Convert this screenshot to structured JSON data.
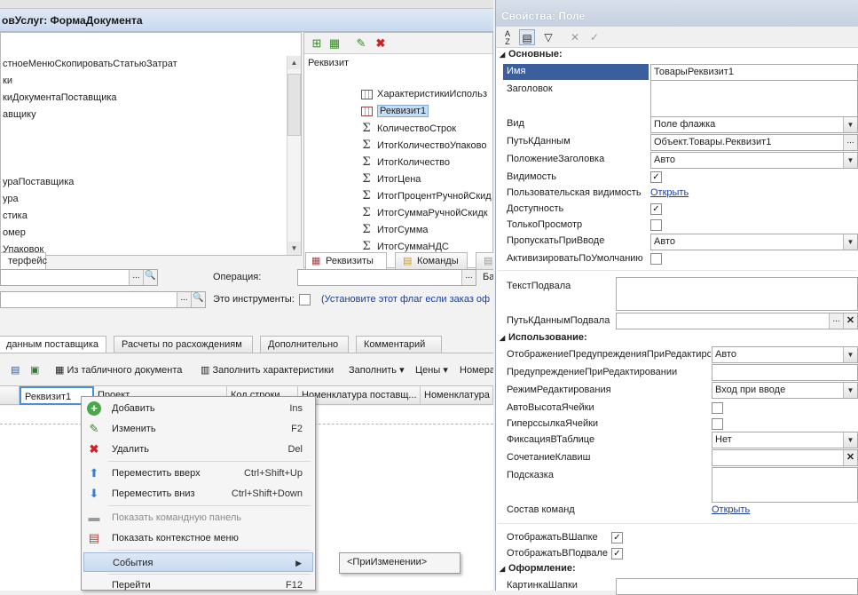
{
  "left": {
    "form_title": "овУслуг: ФормаДокумента",
    "tree_items": [
      "стноеМенюСкопироватьСтатьюЗатрат",
      "ки",
      "киДокументаПоставщика",
      "авщику",
      "",
      "",
      "",
      "",
      "ураПоставщика",
      "ура",
      "стика",
      "омер",
      "Упаковок"
    ],
    "interface_tab": "терфейс",
    "attr_header": "Реквизит",
    "attributes": [
      {
        "icon": "table",
        "label": "ХарактеристикиИспольз"
      },
      {
        "icon": "table",
        "label": "Реквизит1",
        "selected": true
      },
      {
        "icon": "sigma",
        "label": "КоличествоСтрок"
      },
      {
        "icon": "sigma",
        "label": "ИтогКоличествоУпаково"
      },
      {
        "icon": "sigma",
        "label": "ИтогКоличество"
      },
      {
        "icon": "sigma",
        "label": "ИтогЦена"
      },
      {
        "icon": "sigma",
        "label": "ИтогПроцентРучнойСкид"
      },
      {
        "icon": "sigma",
        "label": "ИтогСуммаРучнойСкидк"
      },
      {
        "icon": "sigma",
        "label": "ИтогСумма"
      },
      {
        "icon": "sigma",
        "label": "ИтогСуммаНДС"
      }
    ],
    "attr_tabs": [
      "Реквизиты",
      "Команды",
      "Ба"
    ],
    "operation_label": "Операция:",
    "ba_label": "Ба",
    "tools_label": "Это инструменты:",
    "tools_hint": "(Установите этот флаг если заказ оф",
    "doc_tabs": [
      "данным поставщика",
      "Расчеты по расхождениям",
      "Дополнительно",
      "Комментарий"
    ],
    "doc_toolbar": {
      "from_table": "Из табличного документа",
      "fill_characteristics": "Заполнить характеристики",
      "fill": "Заполнить",
      "prices": "Цены",
      "number": "Номера"
    },
    "grid_columns": [
      "Реквизит1",
      "Проект",
      "Код строки",
      "Номенклатура поставщ...",
      "Номенклатура"
    ]
  },
  "context_menu": {
    "items": [
      {
        "icon": "add-icon",
        "label": "Добавить",
        "shortcut": "Ins"
      },
      {
        "icon": "edit-icon",
        "label": "Изменить",
        "shortcut": "F2"
      },
      {
        "icon": "delete-icon",
        "label": "Удалить",
        "shortcut": "Del"
      },
      {
        "icon": "move-up-icon",
        "label": "Переместить вверх",
        "shortcut": "Ctrl+Shift+Up"
      },
      {
        "icon": "move-down-icon",
        "label": "Переместить вниз",
        "shortcut": "Ctrl+Shift+Down"
      },
      {
        "icon": "command-panel-icon",
        "label": "Показать командную панель",
        "shortcut": ""
      },
      {
        "icon": "context-menu-icon",
        "label": "Показать контекстное меню",
        "shortcut": ""
      },
      {
        "icon": "",
        "label": "События",
        "shortcut": ""
      },
      {
        "icon": "",
        "label": "Перейти",
        "shortcut": "F12"
      }
    ],
    "submenu_item": "<ПриИзменении>"
  },
  "props": {
    "title": "Свойства: Поле",
    "sections": {
      "main": "Основные:",
      "usage": "Использование:",
      "design": "Оформление:"
    },
    "labels": {
      "name": "Имя",
      "title": "Заголовок",
      "kind": "Вид",
      "data_path": "ПутьКДанным",
      "title_position": "ПоложениеЗаголовка",
      "visibility": "Видимость",
      "user_visibility": "Пользовательская видимость",
      "availability": "Доступность",
      "read_only": "ТолькоПросмотр",
      "skip_on_input": "ПропускатьПриВводе",
      "activate_default": "АктивизироватьПоУмолчанию",
      "footer_text": "ТекстПодвала",
      "footer_data_path": "ПутьКДаннымПодвала",
      "edit_warning_display": "ОтображениеПредупрежденияПриРедактиро",
      "edit_warning": "ПредупреждениеПриРедактировании",
      "edit_mode": "РежимРедактирования",
      "auto_cell_height": "АвтоВысотаЯчейки",
      "cell_hyperlink": "ГиперссылкаЯчейки",
      "fixing_in_table": "ФиксацияВТаблице",
      "shortcut": "СочетаниеКлавиш",
      "tooltip": "Подсказка",
      "commands": "Состав команд",
      "show_in_header": "ОтображатьВШапке",
      "show_in_footer": "ОтображатьВПодвале",
      "header_picture": "КартинкаШапки"
    },
    "values": {
      "name": "ТоварыРеквизит1",
      "kind": "Поле флажка",
      "data_path": "Объект.Товары.Реквизит1",
      "title_position": "Авто",
      "open_link": "Открыть",
      "skip_on_input": "Авто",
      "edit_warning_display": "Авто",
      "edit_mode": "Вход при вводе",
      "fixing_in_table": "Нет",
      "commands_link": "Открыть"
    },
    "checks": {
      "visibility": true,
      "availability": true,
      "read_only": false,
      "activate_default": false,
      "auto_cell_height": false,
      "cell_hyperlink": false,
      "show_in_header": true,
      "show_in_footer": true
    }
  }
}
